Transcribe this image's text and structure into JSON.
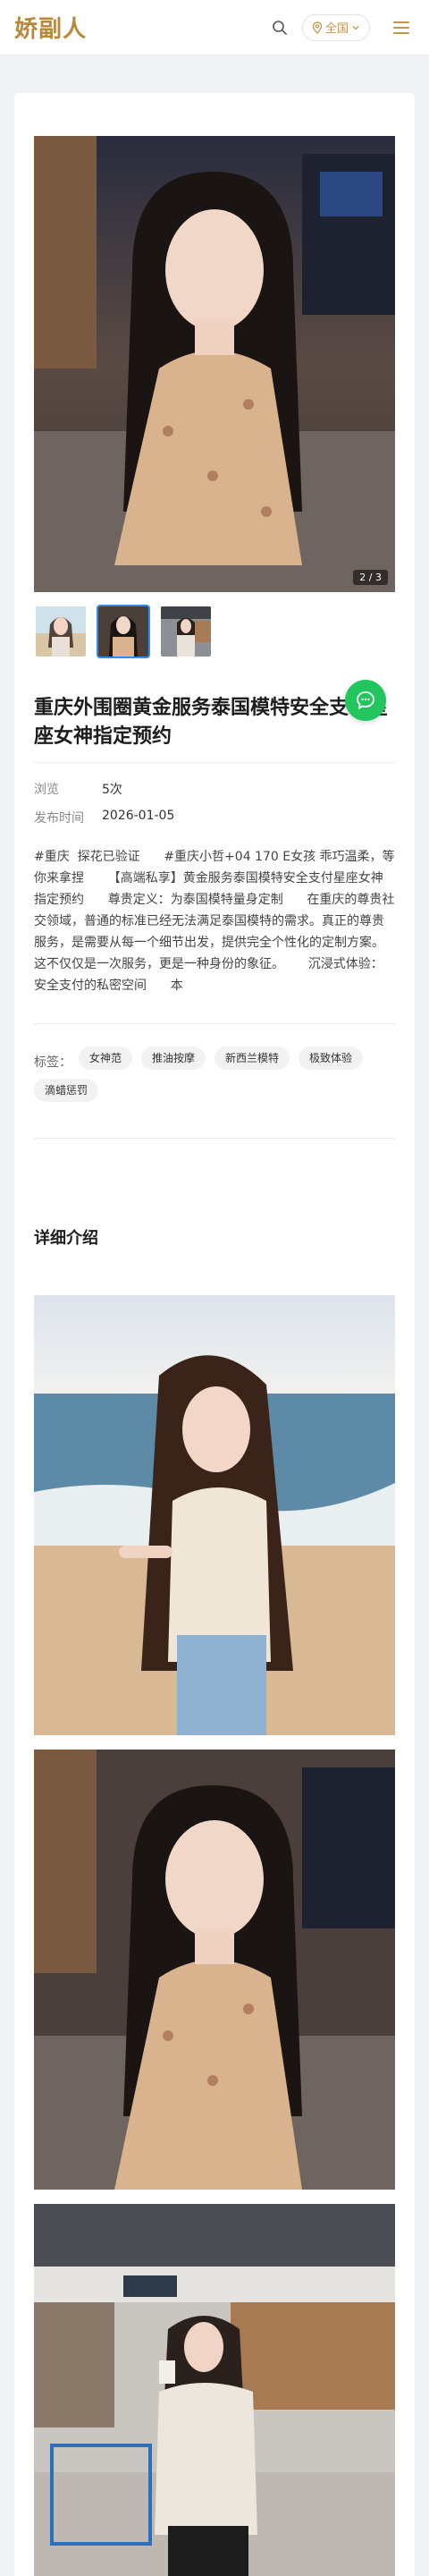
{
  "header": {
    "logo": "娇副人",
    "region_label": "全国"
  },
  "gallery": {
    "counter": "2 / 3",
    "thumb_count": 3,
    "active_index": 1
  },
  "post": {
    "title": "重庆外围圈黄金服务泰国模特安全支付星座女神指定预约",
    "meta": [
      {
        "key": "浏览",
        "value": "5次"
      },
      {
        "key": "发布时间",
        "value": "2026-01-05"
      }
    ],
    "description": "#重庆  探花已验证      #重庆小哲+04 170 E女孩 乖巧温柔，等你来拿捏      【高端私享】黄金服务泰国模特安全支付星座女神指定预约      尊贵定义：为泰国模特量身定制      在重庆的尊贵社交领域，普通的标准已经无法满足泰国模特的需求。真正的尊贵服务，是需要从每一个细节出发，提供完全个性化的定制方案。这不仅仅是一次服务，更是一种身份的象征。      沉浸式体验：安全支付的私密空间      本",
    "tags_label": "标签：",
    "tags": [
      "女神范",
      "推油按摩",
      "新西兰模特",
      "极致体验",
      "滴蜡惩罚"
    ]
  },
  "details": {
    "section_title": "详细介绍"
  }
}
